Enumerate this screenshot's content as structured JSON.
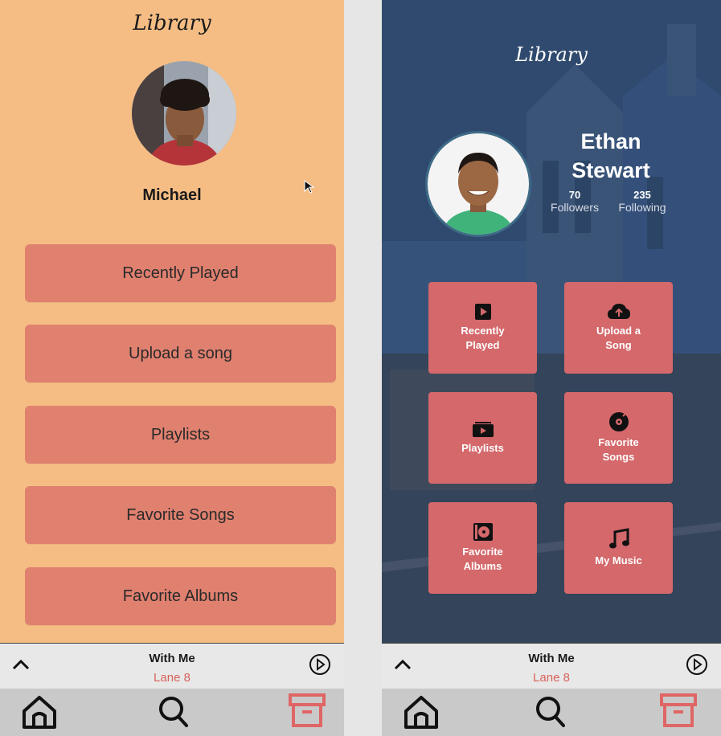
{
  "left_screen": {
    "title": "Library",
    "user_name": "Michael",
    "menu": [
      {
        "label": "Recently Played"
      },
      {
        "label": "Upload a song"
      },
      {
        "label": "Playlists"
      },
      {
        "label": "Favorite Songs"
      },
      {
        "label": "Favorite Albums"
      }
    ],
    "player": {
      "song": "With Me",
      "artist": "Lane 8",
      "expand_icon": "chevron-up-icon",
      "play_icon": "play-circle-icon"
    },
    "tabs": [
      {
        "icon": "home-icon"
      },
      {
        "icon": "search-icon"
      },
      {
        "icon": "archive-icon"
      }
    ],
    "colors": {
      "background": "#f5bd84",
      "button": "#e0806f",
      "accent": "#d9625a"
    }
  },
  "right_screen": {
    "title": "Library",
    "user_name_line1": "Ethan",
    "user_name_line2": "Stewart",
    "stats": {
      "followers_count": "70",
      "followers_label": "Followers",
      "following_count": "235",
      "following_label": "Following"
    },
    "tiles": [
      {
        "label": "Recently\nPlayed",
        "icon": "play-square-icon"
      },
      {
        "label": "Upload a\nSong",
        "icon": "cloud-upload-icon"
      },
      {
        "label": "Playlists",
        "icon": "playlist-folder-icon"
      },
      {
        "label": "Favorite\nSongs",
        "icon": "vinyl-record-icon"
      },
      {
        "label": "Favorite\nAlbums",
        "icon": "album-icon"
      },
      {
        "label": "My Music",
        "icon": "music-note-icon"
      }
    ],
    "player": {
      "song": "With Me",
      "artist": "Lane 8",
      "expand_icon": "chevron-up-icon",
      "play_icon": "play-circle-icon"
    },
    "tabs": [
      {
        "icon": "home-icon"
      },
      {
        "icon": "search-icon"
      },
      {
        "icon": "archive-icon"
      }
    ],
    "colors": {
      "tile": "#d4686b",
      "overlay": "#2f4a6e",
      "accent": "#d9625a"
    }
  }
}
